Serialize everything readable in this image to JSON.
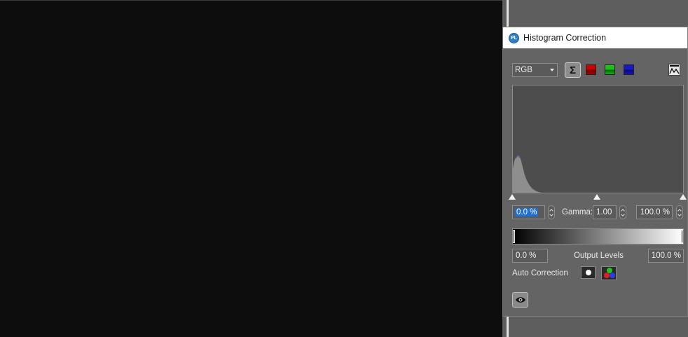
{
  "window": {
    "title": "Histogram Correction",
    "app_icon_text": "PL"
  },
  "channel": {
    "selected": "RGB"
  },
  "icons": {
    "sum": "sigma-icon",
    "red": "red-channel-icon",
    "green": "green-channel-icon",
    "blue": "blue-channel-icon",
    "curve": "histogram-curve-icon",
    "auto_mono": "auto-mono-icon",
    "auto_rgb": "auto-rgb-icon",
    "preview": "eye-icon"
  },
  "sigma_glyph": "Σ",
  "input_levels": {
    "black": "0.0 %",
    "gamma_label": "Gamma:",
    "gamma": "1.00",
    "white": "100.0 %"
  },
  "output_levels": {
    "black": "0.0 %",
    "label": "Output Levels",
    "white": "100.0 %"
  },
  "auto_correction": {
    "label": "Auto Correction"
  },
  "colors": {
    "panel_bg": "#646464",
    "histogram_bg": "#4d4d4d",
    "selection": "#1e6fd0",
    "canvas": "#0d0d0d"
  }
}
